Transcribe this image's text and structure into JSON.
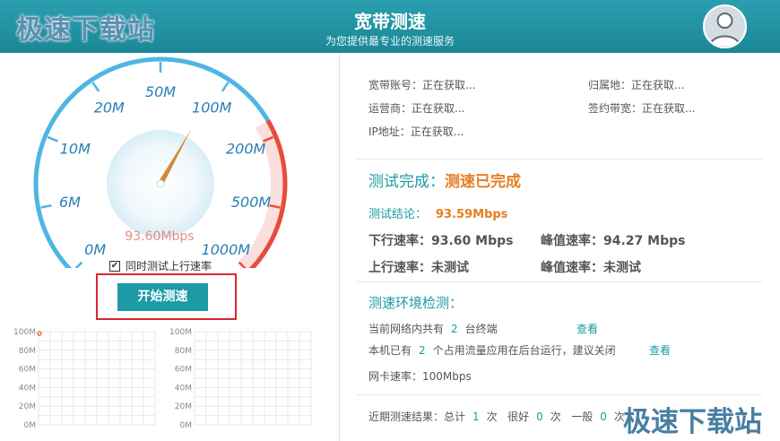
{
  "header": {
    "logo_text": "极速下载站",
    "title": "宽带测速",
    "subtitle": "为您提供最专业的测速服务"
  },
  "gauge": {
    "labels": [
      "0M",
      "6M",
      "10M",
      "20M",
      "50M",
      "100M",
      "200M",
      "500M",
      "1000M"
    ],
    "needle_value": 93.6,
    "speed_readout": "93.60Mbps",
    "colors": {
      "arc": "#4db6e5",
      "high_arc": "#e74c3c",
      "needle": "#d18a3a"
    }
  },
  "options": {
    "check_mark": "✔",
    "upload_test_label": "同时测试上行速率",
    "upload_test_checked": true
  },
  "start_button": {
    "label": "开始测速"
  },
  "mini_charts": [
    {
      "y_labels": [
        "100M",
        "80M",
        "60M",
        "40M",
        "20M",
        "0M"
      ]
    },
    {
      "y_labels": [
        "100M",
        "80M",
        "60M",
        "40M",
        "20M",
        "0M"
      ]
    }
  ],
  "account_info": {
    "account": "宽带账号：正在获取...",
    "location": "归属地：正在获取...",
    "isp": "运营商：正在获取...",
    "bandwidth": "签约带宽：正在获取...",
    "ip": "IP地址：正在获取..."
  },
  "result": {
    "status_label": "测试完成：",
    "status_value": "测速已完成",
    "conclusion_label": "测试结论：",
    "conclusion_value": "93.59Mbps",
    "download": "下行速率：93.60 Mbps",
    "download_peak": "峰值速率：94.27 Mbps",
    "upload": "上行速率：未测试",
    "upload_peak": "峰值速率：未测试"
  },
  "environment": {
    "title": "测速环境检测：",
    "devices_prefix": "当前网络内共有",
    "devices_count": "2",
    "devices_suffix": "台终端",
    "devices_link": "查看",
    "apps_prefix": "本机已有",
    "apps_count": "2",
    "apps_suffix": "个占用流量应用在后台运行，建议关闭",
    "apps_link": "查看",
    "nic_speed": "网卡速率：100Mbps"
  },
  "recent": {
    "prefix": "近期测速结果：总计",
    "total": "1",
    "unit1": "次",
    "good_label": "很好",
    "good": "0",
    "unit2": "次",
    "normal_label": "一般",
    "normal": "0",
    "unit3": "次"
  },
  "watermark": "极速下载站"
}
